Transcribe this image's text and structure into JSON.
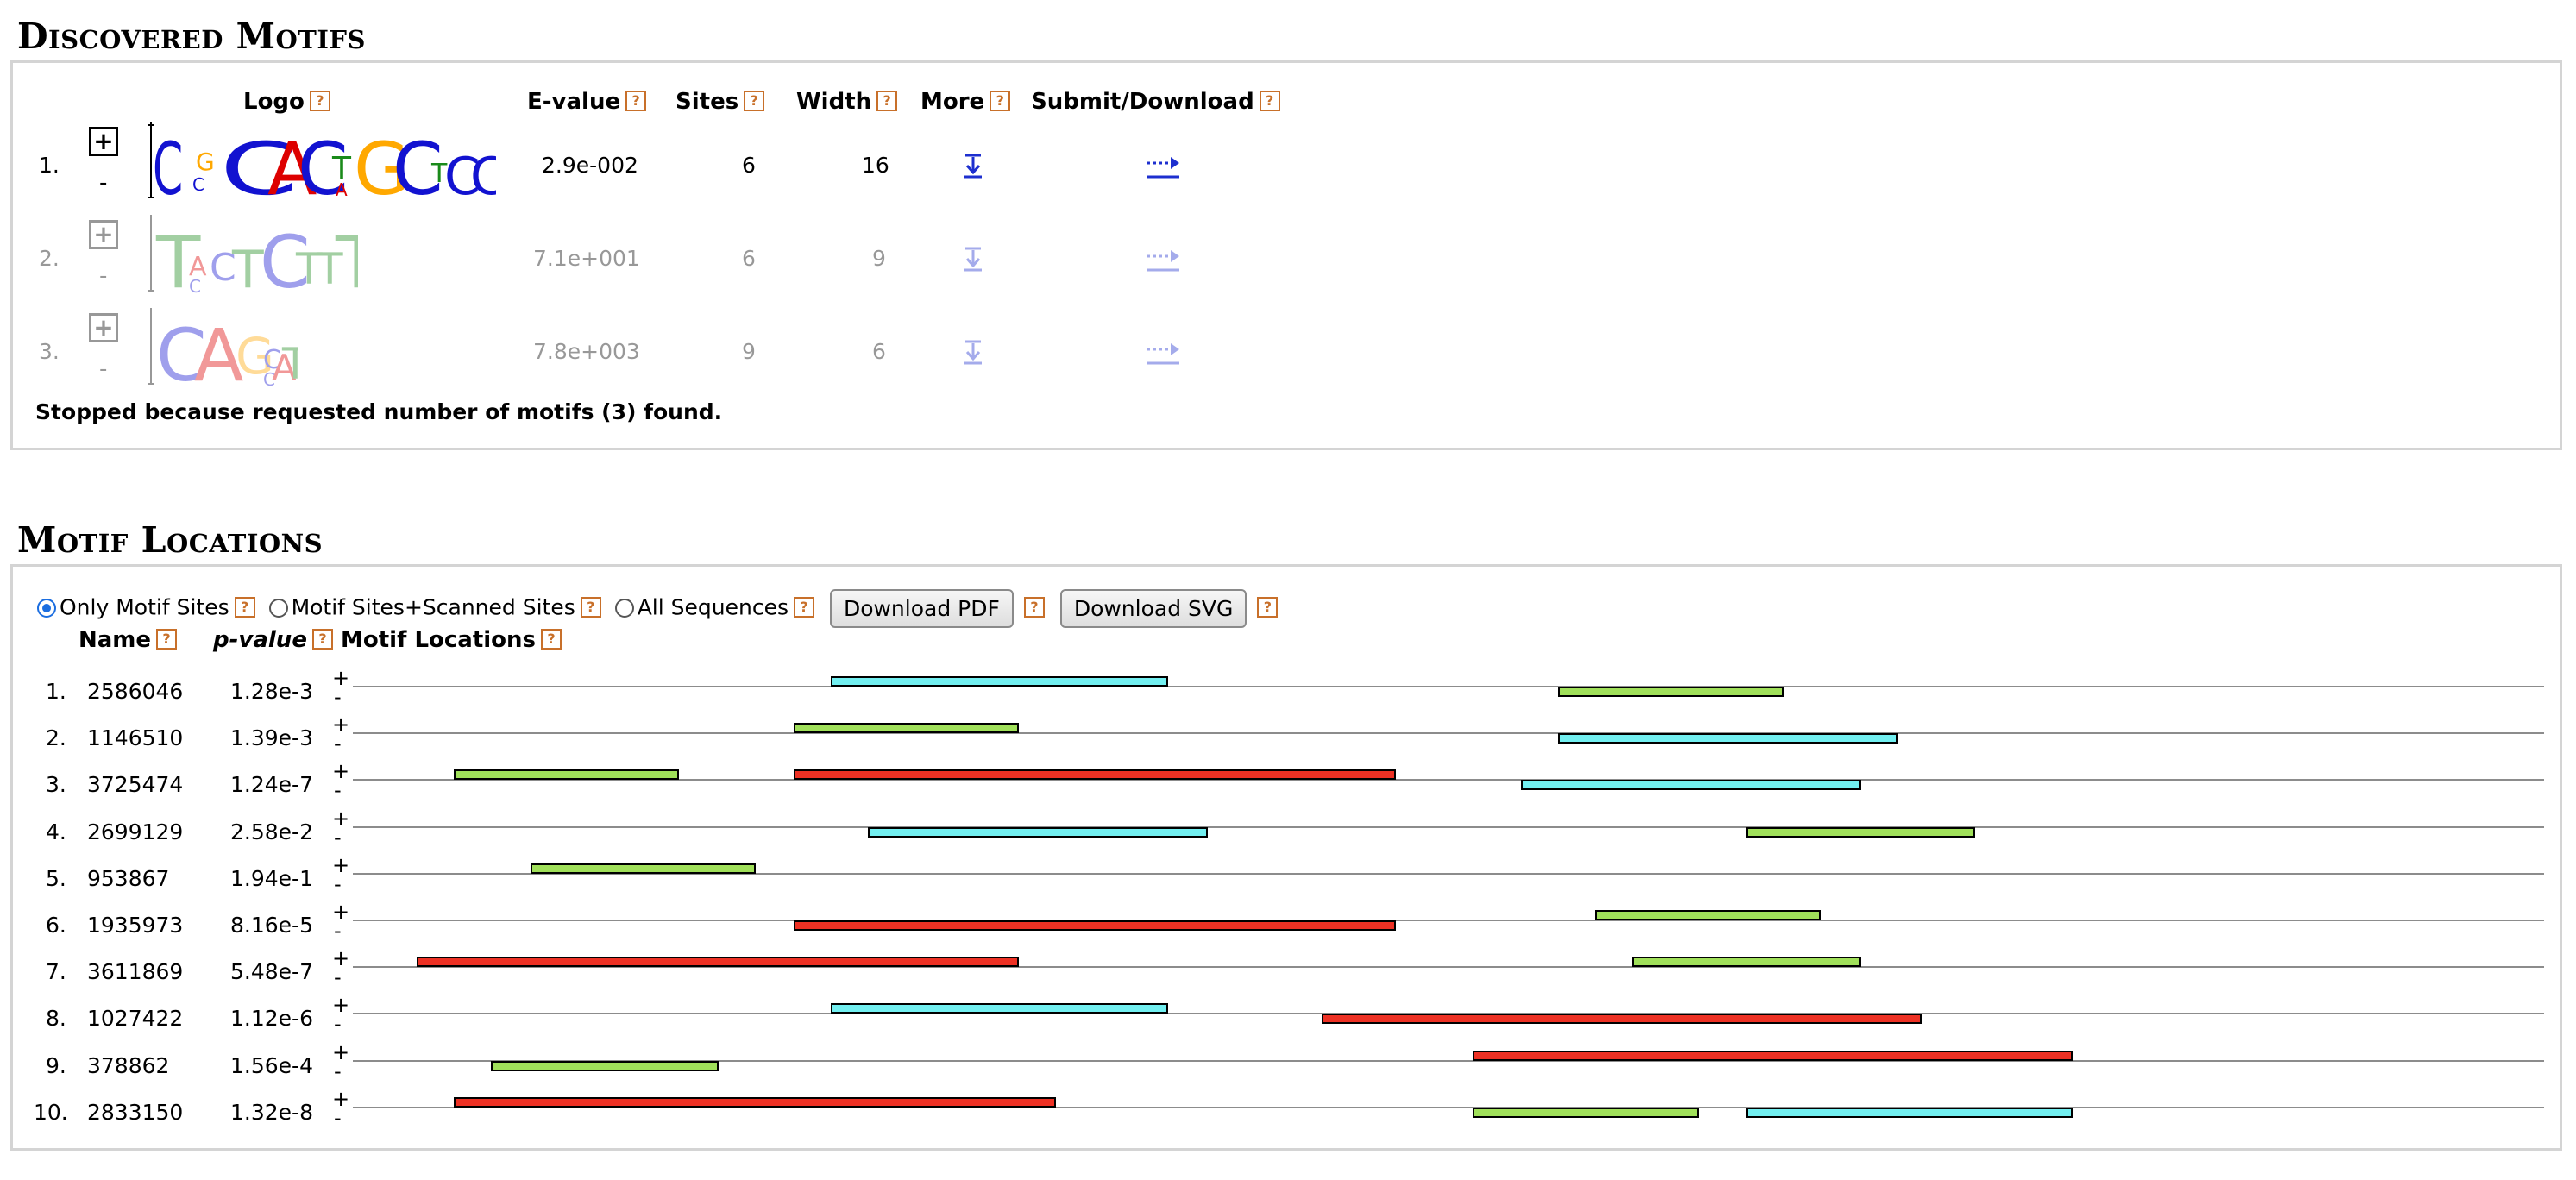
{
  "discovered": {
    "title": "Discovered Motifs",
    "headers": {
      "logo": "Logo",
      "evalue": "E-value",
      "sites": "Sites",
      "width": "Width",
      "more": "More",
      "submit": "Submit/Download"
    },
    "help_glyph": "?",
    "motifs": [
      {
        "num": "1.",
        "expand": "+",
        "collapse": "-",
        "evalue": "2.9e-002",
        "sites": "6",
        "width": "16",
        "logo_letters": "CCGCACTGGCTCTCTC"
      },
      {
        "num": "2.",
        "expand": "+",
        "collapse": "-",
        "evalue": "7.1e+001",
        "sites": "6",
        "width": "9",
        "logo_letters": "TACCTCTTT"
      },
      {
        "num": "3.",
        "expand": "+",
        "collapse": "-",
        "evalue": "7.8e+003",
        "sites": "9",
        "width": "6",
        "logo_letters": "CAGCAT"
      }
    ],
    "stop_reason": "Stopped because requested number of motifs (3) found."
  },
  "locations": {
    "title": "Motif Locations",
    "options": [
      {
        "label": "Only Motif Sites",
        "checked": true
      },
      {
        "label": "Motif Sites+Scanned Sites",
        "checked": false
      },
      {
        "label": "All Sequences",
        "checked": false
      }
    ],
    "buttons": {
      "pdf": "Download PDF",
      "svg": "Download SVG"
    },
    "headers": {
      "name": "Name",
      "pvalue": "p-value",
      "locations": "Motif Locations"
    },
    "plus": "+",
    "minus": "-",
    "colors": {
      "motif1": "#ed3124",
      "motif2": "#72eff0",
      "motif3": "#a0e05a"
    },
    "rows": [
      {
        "num": "1.",
        "name": "2586046",
        "pvalue": "1.28e-3",
        "sites": [
          {
            "motif": 2,
            "strand": "+",
            "start": 0.218,
            "end": 0.372
          },
          {
            "motif": 3,
            "strand": "-",
            "start": 0.55,
            "end": 0.653
          }
        ]
      },
      {
        "num": "2.",
        "name": "1146510",
        "pvalue": "1.39e-3",
        "sites": [
          {
            "motif": 3,
            "strand": "+",
            "start": 0.201,
            "end": 0.304
          },
          {
            "motif": 2,
            "strand": "-",
            "start": 0.55,
            "end": 0.705
          }
        ]
      },
      {
        "num": "3.",
        "name": "3725474",
        "pvalue": "1.24e-7",
        "sites": [
          {
            "motif": 3,
            "strand": "+",
            "start": 0.046,
            "end": 0.149
          },
          {
            "motif": 1,
            "strand": "+",
            "start": 0.201,
            "end": 0.476
          },
          {
            "motif": 2,
            "strand": "-",
            "start": 0.533,
            "end": 0.688
          }
        ]
      },
      {
        "num": "4.",
        "name": "2699129",
        "pvalue": "2.58e-2",
        "sites": [
          {
            "motif": 2,
            "strand": "-",
            "start": 0.235,
            "end": 0.39
          },
          {
            "motif": 3,
            "strand": "-",
            "start": 0.636,
            "end": 0.74
          }
        ]
      },
      {
        "num": "5.",
        "name": "953867",
        "pvalue": "1.94e-1",
        "sites": [
          {
            "motif": 3,
            "strand": "+",
            "start": 0.081,
            "end": 0.184
          }
        ]
      },
      {
        "num": "6.",
        "name": "1935973",
        "pvalue": "8.16e-5",
        "sites": [
          {
            "motif": 1,
            "strand": "-",
            "start": 0.201,
            "end": 0.476
          },
          {
            "motif": 3,
            "strand": "+",
            "start": 0.567,
            "end": 0.67
          }
        ]
      },
      {
        "num": "7.",
        "name": "3611869",
        "pvalue": "5.48e-7",
        "sites": [
          {
            "motif": 1,
            "strand": "+",
            "start": 0.029,
            "end": 0.304
          },
          {
            "motif": 3,
            "strand": "+",
            "start": 0.584,
            "end": 0.688
          }
        ]
      },
      {
        "num": "8.",
        "name": "1027422",
        "pvalue": "1.12e-6",
        "sites": [
          {
            "motif": 2,
            "strand": "+",
            "start": 0.218,
            "end": 0.372
          },
          {
            "motif": 1,
            "strand": "-",
            "start": 0.442,
            "end": 0.716
          }
        ]
      },
      {
        "num": "9.",
        "name": "378862",
        "pvalue": "1.56e-4",
        "sites": [
          {
            "motif": 3,
            "strand": "-",
            "start": 0.063,
            "end": 0.167
          },
          {
            "motif": 1,
            "strand": "+",
            "start": 0.511,
            "end": 0.785
          }
        ]
      },
      {
        "num": "10.",
        "name": "2833150",
        "pvalue": "1.32e-8",
        "sites": [
          {
            "motif": 1,
            "strand": "+",
            "start": 0.046,
            "end": 0.321
          },
          {
            "motif": 3,
            "strand": "-",
            "start": 0.511,
            "end": 0.614
          },
          {
            "motif": 2,
            "strand": "-",
            "start": 0.636,
            "end": 0.785
          }
        ]
      }
    ]
  }
}
